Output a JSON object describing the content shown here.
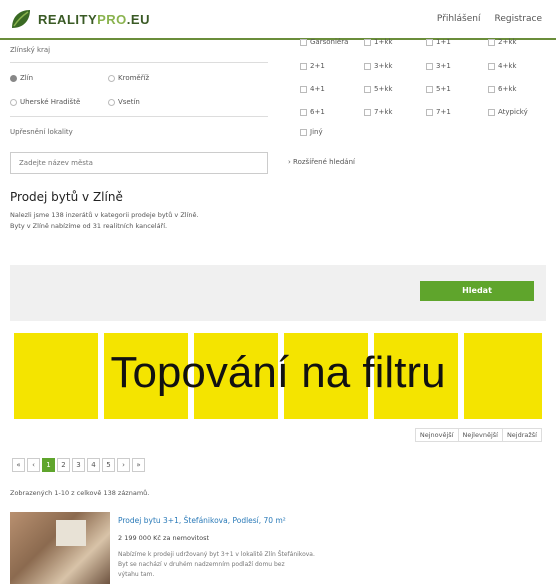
{
  "header": {
    "logo_text_dark": "REALITY",
    "logo_text_light": "PRO",
    "logo_text_suffix": ".EU",
    "nav": {
      "login": "Přihlášení",
      "register": "Registrace"
    },
    "colors": {
      "accent_green": "#5fa52c",
      "brand_dark": "#3a5a25",
      "header_line": "#6a8d3a"
    }
  },
  "filter": {
    "region_label": "Zlínský kraj",
    "districts": [
      {
        "label": "Zlín",
        "selected": true
      },
      {
        "label": "Kroměříž",
        "selected": false
      },
      {
        "label": "Uherské Hradiště",
        "selected": false
      },
      {
        "label": "Vsetín",
        "selected": false
      }
    ],
    "locality_label": "Upřesnění lokality",
    "city_placeholder": "Zadejte název města",
    "rooms": [
      "Garsoniéra",
      "1+kk",
      "1+1",
      "2+kk",
      "2+1",
      "3+kk",
      "3+1",
      "4+kk",
      "4+1",
      "5+kk",
      "5+1",
      "6+kk",
      "6+1",
      "7+kk",
      "7+1",
      "Atypický",
      "Jiný"
    ],
    "advanced_search": "Rozšířené hledání",
    "search_button": "Hledat"
  },
  "content": {
    "title": "Prodej bytů v Zlíně",
    "desc_line1": "Nalezli jsme 138 inzerátů v kategorii prodeje bytů v Zlíně.",
    "desc_line2": "Byty v Zlíně nabízíme od 31 realitních kanceláří.",
    "banner_text": "Topování na filtru",
    "banner_color": "#f4e400"
  },
  "sorting": {
    "newest": "Nejnovější",
    "cheapest": "Nejlevnější",
    "priciest": "Nejdražší"
  },
  "pagination": {
    "first": "«",
    "prev": "‹",
    "pages": [
      "1",
      "2",
      "3",
      "4",
      "5"
    ],
    "active": "1",
    "next": "›",
    "last": "»"
  },
  "results": {
    "count_text": "Zobrazených 1-10 z celkově 138 záznamů.",
    "listing": {
      "title": "Prodej bytu 3+1, Štefánikova, Podlesí, 70 m²",
      "price": "2 199 000 Kč za nemovitost",
      "text_line1": "Nabízíme k prodeji udržovaný byt 3+1 v lokalitě Zlín Štefánikova.",
      "text_line2": "Byt se nachází v druhém nadzemním podlaží domu bez",
      "text_line3": "výtahu tam."
    }
  }
}
